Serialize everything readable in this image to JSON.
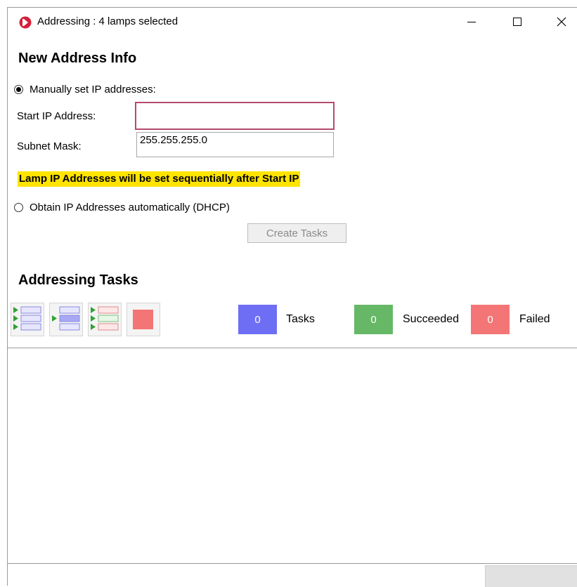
{
  "window": {
    "title": "Addressing : 4 lamps selected",
    "controls": {
      "minimize": "—",
      "maximize": "☐",
      "close": "✕"
    }
  },
  "new_address": {
    "heading": "New Address Info",
    "manual_option": {
      "label": "Manually set IP addresses:",
      "checked": true
    },
    "start_ip": {
      "label": "Start IP Address:",
      "value": ""
    },
    "subnet_mask": {
      "label": "Subnet Mask:",
      "value": "255.255.255.0"
    },
    "note": "Lamp IP Addresses will be set sequentially after Start IP",
    "dhcp_option": {
      "label": "Obtain IP Addresses automatically (DHCP)",
      "checked": false
    },
    "create_tasks_label": "Create Tasks"
  },
  "tasks": {
    "heading": "Addressing Tasks",
    "toolbar_icons": [
      "run-all-tasks-icon",
      "run-selected-task-icon",
      "run-failed-tasks-icon",
      "stop-icon"
    ],
    "counters": [
      {
        "count": "0",
        "label": "Tasks",
        "color": "#6e6ef5"
      },
      {
        "count": "0",
        "label": "Succeeded",
        "color": "#66b866"
      },
      {
        "count": "0",
        "label": "Failed",
        "color": "#f47575"
      }
    ]
  },
  "colors": {
    "highlight": "#ffe400",
    "focus_border": "#b44a6e",
    "brand": "#d6203a"
  }
}
